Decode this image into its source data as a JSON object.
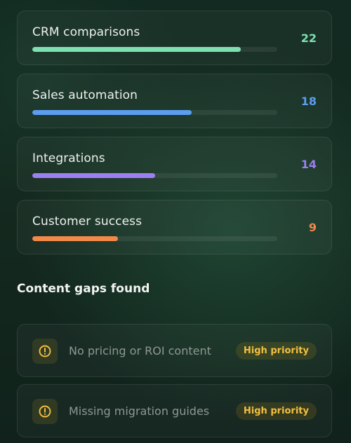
{
  "topics": [
    {
      "label": "CRM comparisons",
      "count": "22",
      "progress": 0.85,
      "color": "#7ee0b0"
    },
    {
      "label": "Sales automation",
      "count": "18",
      "progress": 0.65,
      "color": "#5b9def"
    },
    {
      "label": "Integrations",
      "count": "14",
      "progress": 0.5,
      "color": "#9c7ff0"
    },
    {
      "label": "Customer success",
      "count": "9",
      "progress": 0.35,
      "color": "#f0894a"
    }
  ],
  "gaps_section": {
    "title": "Content gaps found",
    "items": [
      {
        "text": "No pricing or ROI content",
        "badge": "High priority",
        "icon": "alert-circle-icon"
      },
      {
        "text": "Missing migration guides",
        "badge": "High priority",
        "icon": "alert-circle-icon"
      }
    ]
  },
  "colors": {
    "warning": "#f1c040",
    "count_colors": [
      "#7ee0b0",
      "#5b9def",
      "#9c7ff0",
      "#f0894a"
    ]
  }
}
